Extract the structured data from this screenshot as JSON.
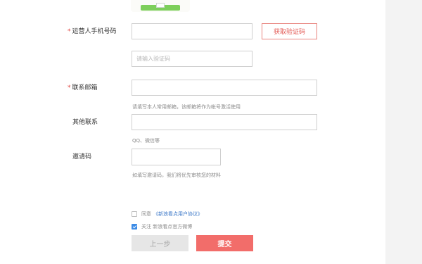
{
  "form": {
    "phone": {
      "label": "运营人手机号码",
      "required_mark": "*",
      "value": ""
    },
    "get_code_button": "获取验证码",
    "code_input": {
      "placeholder": "请输入验证码"
    },
    "email": {
      "label": "联系邮箱",
      "required_mark": "*",
      "value": "",
      "hint": "请填写本人常用邮箱，该邮箱将作为帐号激活使用"
    },
    "other_contact": {
      "label": "其他联系",
      "value": "",
      "hint": "QQ、微信等"
    },
    "invite_code": {
      "label": "邀请码",
      "value": "",
      "hint": "如填写邀请码，我们将优先审核您的材料"
    },
    "agreement": {
      "prefix": "同意",
      "link": "《新浪看点用户协议》",
      "checked": false
    },
    "follow": {
      "text": "关注 新浪看点官方微博",
      "checked": true
    }
  },
  "buttons": {
    "prev": "上一步",
    "submit": "提交"
  },
  "colors": {
    "accent": "#f26d6a",
    "link": "#3c78c8",
    "required": "#e0433f",
    "checkbox": "#3c8be6"
  }
}
